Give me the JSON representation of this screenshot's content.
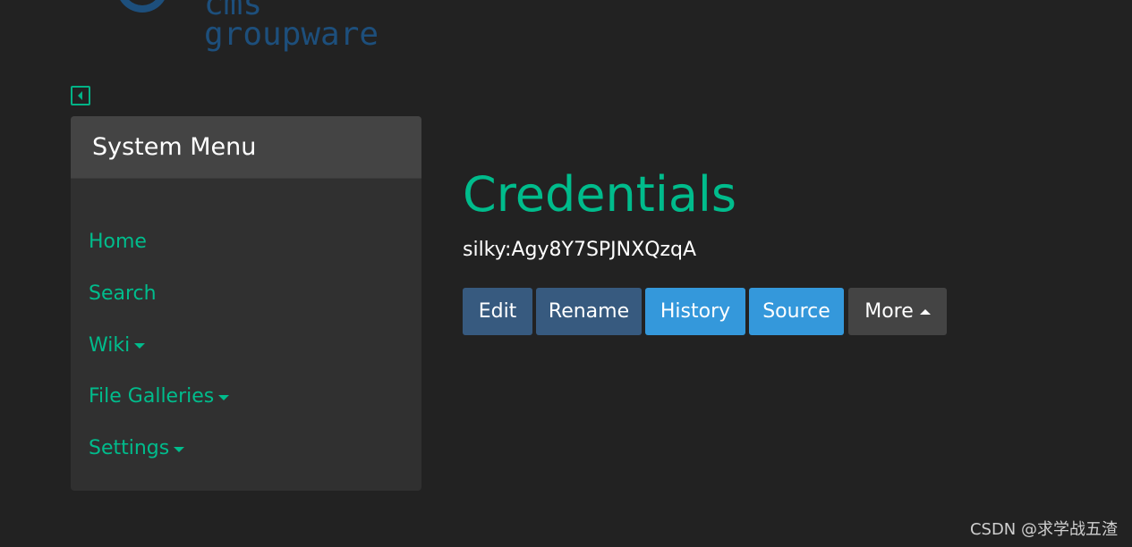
{
  "logo": {
    "line1": "cms",
    "line2": "groupware"
  },
  "sidebar_toggle": {
    "icon": "caret-left-square-icon"
  },
  "system_menu": {
    "title": "System Menu",
    "items": [
      {
        "label": "Home",
        "has_dropdown": false
      },
      {
        "label": "Search",
        "has_dropdown": false
      },
      {
        "label": "Wiki",
        "has_dropdown": true
      },
      {
        "label": "File Galleries",
        "has_dropdown": true
      },
      {
        "label": "Settings",
        "has_dropdown": true
      }
    ]
  },
  "page": {
    "title": "Credentials",
    "content": "silky:Agy8Y7SPJNXQzqA"
  },
  "actions": {
    "edit": "Edit",
    "rename": "Rename",
    "history": "History",
    "source": "Source",
    "more": "More"
  },
  "watermark": "CSDN @求学战五渣",
  "colors": {
    "background": "#222222",
    "accent": "#00bc8c",
    "primary": "#375a7f",
    "info": "#3498db",
    "secondary": "#444444"
  }
}
